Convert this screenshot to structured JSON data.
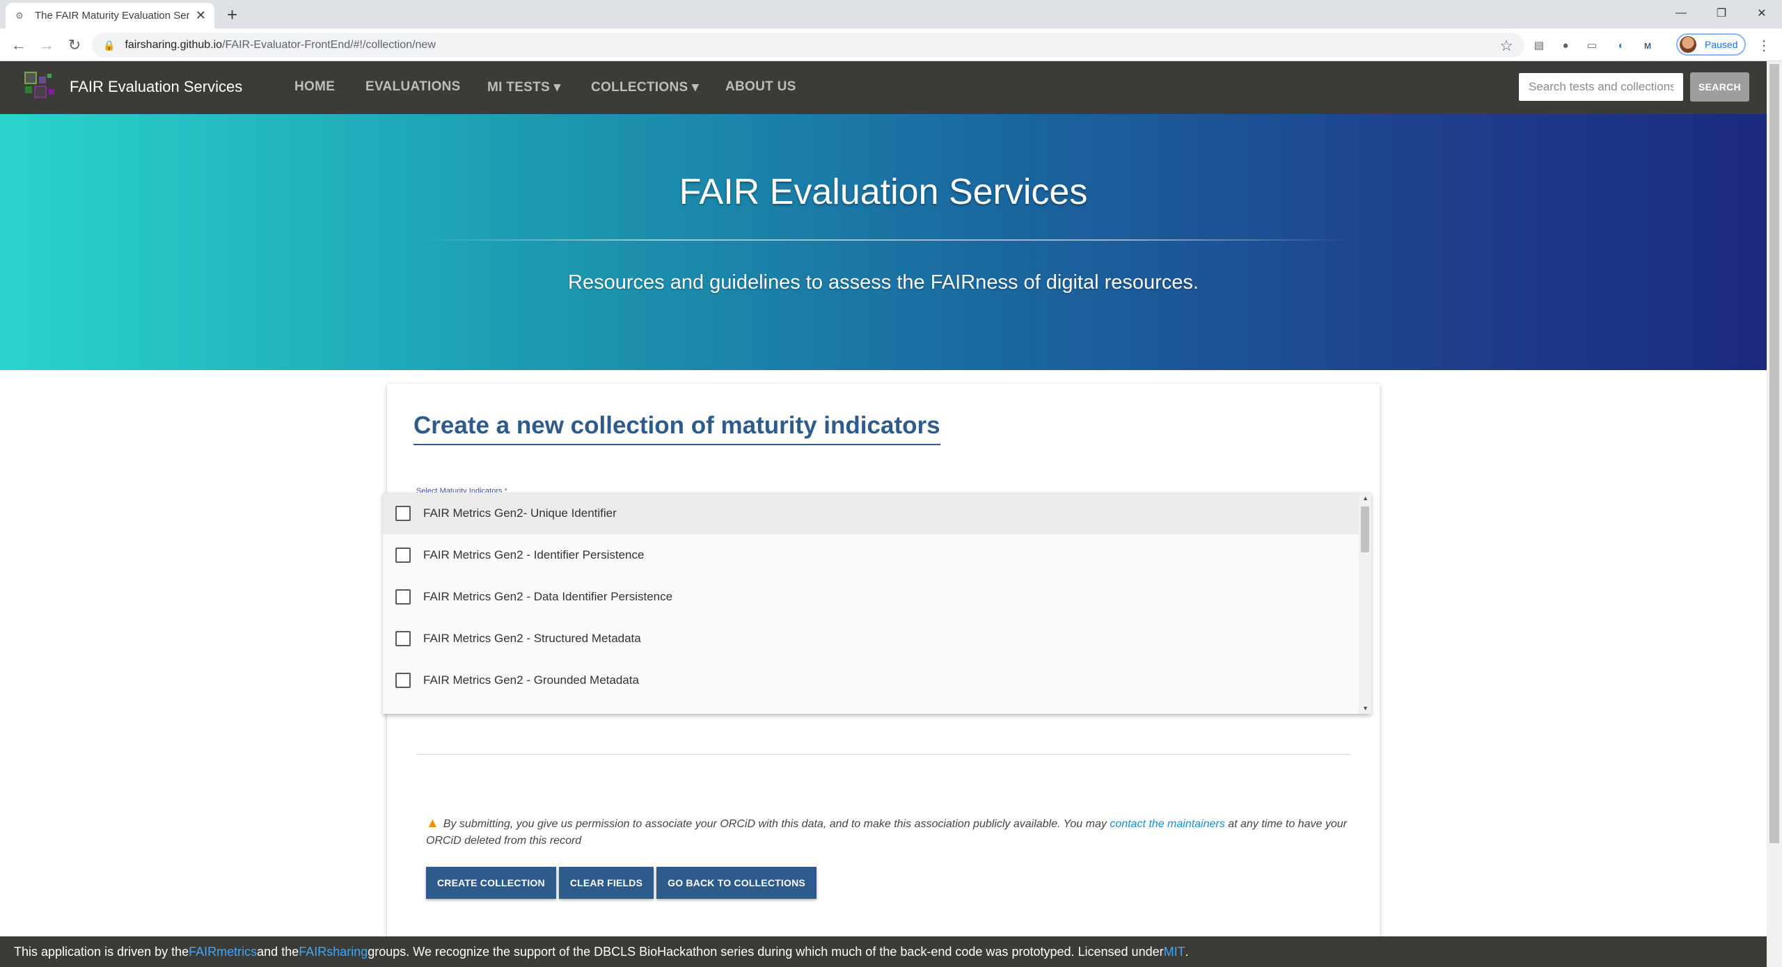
{
  "browser": {
    "tab_title": "The FAIR Maturity Evaluation Ser",
    "tab_close": "✕",
    "new_tab": "+",
    "url_host": "fairsharing.github.io",
    "url_path": "/FAIR-Evaluator-FrontEnd/#!/collection/new",
    "profile_status": "Paused"
  },
  "site": {
    "brand": "FAIR Evaluation Services",
    "nav": [
      "HOME",
      "EVALUATIONS",
      "MI TESTS ▾",
      "COLLECTIONS ▾",
      "ABOUT US"
    ],
    "search_placeholder": "Search tests and collections",
    "search_button": "SEARCH"
  },
  "hero": {
    "title": "FAIR Evaluation Services",
    "subtitle": "Resources and guidelines to assess the FAIRness of digital resources."
  },
  "form": {
    "heading": "Create a new collection of maturity indicators",
    "field_label": "Select Maturity Indicators",
    "required_mark": "*",
    "options": [
      "FAIR Metrics Gen2- Unique Identifier",
      "FAIR Metrics Gen2 - Identifier Persistence",
      "FAIR Metrics Gen2 - Data Identifier Persistence",
      "FAIR Metrics Gen2 - Structured Metadata",
      "FAIR Metrics Gen2 - Grounded Metadata"
    ],
    "notice_before": "By submitting, you give us permission to associate your ORCiD with this data, and to make this association publicly available. You may ",
    "notice_link": "contact the maintainers",
    "notice_after": " at any time to have your ORCiD deleted from this record",
    "buttons": {
      "create": "CREATE COLLECTION",
      "clear": "CLEAR FIELDS",
      "back": "GO BACK TO COLLECTIONS"
    }
  },
  "footer": {
    "t1": "This application is driven by the ",
    "link1": "FAIRmetrics",
    "t2": " and the ",
    "link2": "FAIRsharing",
    "t3": " groups. We recognize the support of the DBCLS BioHackathon series during which much of the back-end code was prototyped. Licensed under ",
    "link3": "MIT",
    "t4": "."
  },
  "colors": {
    "navbar": "#3b3b38",
    "heading_blue": "#2d5c8c",
    "link_blue": "#1a8ed6",
    "hero_start": "#2ad4cd",
    "hero_end": "#1b2a7e"
  }
}
